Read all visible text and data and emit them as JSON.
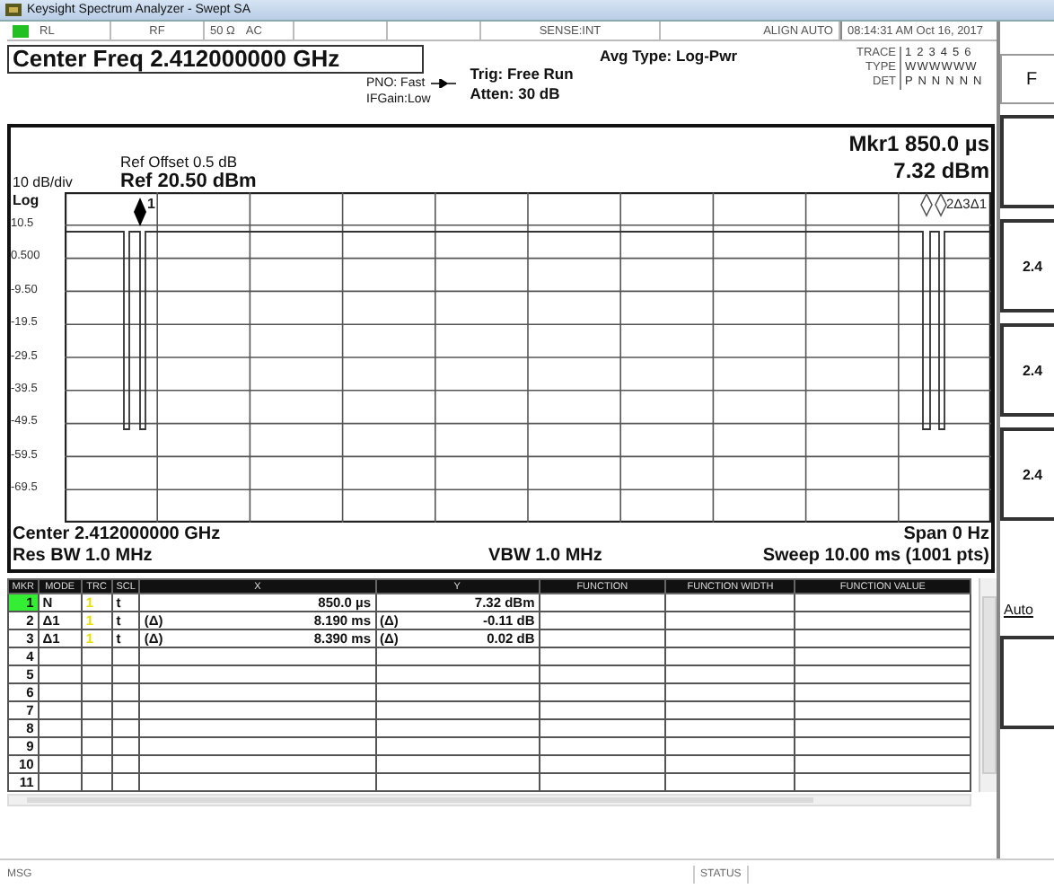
{
  "window": {
    "title": "Keysight Spectrum Analyzer - Swept SA"
  },
  "status_row": {
    "remote": "RL",
    "input": "RF",
    "impedance": "50 Ω",
    "coupling": "AC",
    "sense": "SENSE:INT",
    "align": "ALIGN AUTO",
    "datetime": "08:14:31 AM Oct 16, 2017"
  },
  "settings": {
    "center_freq": "Center Freq 2.412000000 GHz",
    "pno": "PNO: Fast",
    "ifgain": "IFGain:Low",
    "trig": "Trig: Free Run",
    "atten": "Atten: 30 dB",
    "avg_type": "Avg Type: Log-Pwr",
    "trace_label": "TRACE",
    "trace_values": "1 2 3 4 5 6",
    "type_label": "TYPE",
    "type_values": "WWWWWW",
    "det_label": "DET",
    "det_values": "P N N N N N"
  },
  "display": {
    "ref_offset": "Ref Offset 0.5 dB",
    "scale": "10 dB/div",
    "ref_level": "Ref 20.50 dBm",
    "scale_type": "Log",
    "marker_x": "Mkr1 850.0 µs",
    "marker_y": "7.32 dBm",
    "y_labels": [
      "10.5",
      "0.500",
      "-9.50",
      "-19.5",
      "-29.5",
      "-39.5",
      "-49.5",
      "-59.5",
      "-69.5"
    ],
    "marker_labels": [
      "1",
      "2Δ3Δ1"
    ],
    "center": "Center 2.412000000 GHz",
    "rbw": "Res BW 1.0 MHz",
    "vbw": "VBW 1.0 MHz",
    "span": "Span 0 Hz",
    "sweep": "Sweep 10.00 ms (1001 pts)"
  },
  "marker_table": {
    "columns": [
      "MKR",
      "MODE",
      "TRC",
      "SCL",
      "X",
      "Y",
      "FUNCTION",
      "FUNCTION WIDTH",
      "FUNCTION VALUE"
    ],
    "rows": [
      {
        "number": "1",
        "selected": true,
        "mode": "N",
        "trace": "1",
        "scale": "t",
        "x": "850.0 µs",
        "y": "7.32 dBm"
      },
      {
        "number": "2",
        "selected": false,
        "mode": "Δ1",
        "trace": "1",
        "scale": "t",
        "x_ref": "(Δ)",
        "x": "8.190 ms",
        "y_ref": "(Δ)",
        "y": "-0.11 dB"
      },
      {
        "number": "3",
        "selected": false,
        "mode": "Δ1",
        "trace": "1",
        "scale": "t",
        "x_ref": "(Δ)",
        "x": "8.390 ms",
        "y_ref": "(Δ)",
        "y": "0.02 dB"
      },
      {
        "number": "4",
        "selected": false
      },
      {
        "number": "5",
        "selected": false
      },
      {
        "number": "6",
        "selected": false
      },
      {
        "number": "7",
        "selected": false
      },
      {
        "number": "8",
        "selected": false
      },
      {
        "number": "9",
        "selected": false
      },
      {
        "number": "10",
        "selected": false
      },
      {
        "number": "11",
        "selected": false
      }
    ]
  },
  "softkeys": [
    {
      "kind": "title",
      "text": "F"
    },
    {
      "kind": "key"
    },
    {
      "kind": "key",
      "text": "2.4"
    },
    {
      "kind": "key",
      "text": "2.4"
    },
    {
      "kind": "key",
      "text": "2.4"
    },
    {
      "kind": "option",
      "text": "Auto"
    },
    {
      "kind": "key"
    }
  ],
  "status_bar": {
    "msg": "MSG",
    "status": "STATUS"
  }
}
